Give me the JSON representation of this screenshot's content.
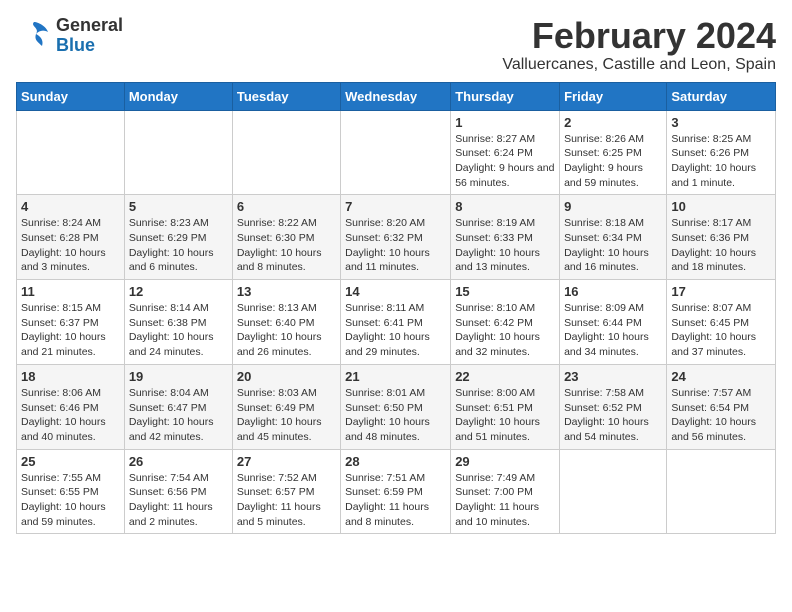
{
  "logo": {
    "general": "General",
    "blue": "Blue"
  },
  "header": {
    "month": "February 2024",
    "location": "Valluercanes, Castille and Leon, Spain"
  },
  "weekdays": [
    "Sunday",
    "Monday",
    "Tuesday",
    "Wednesday",
    "Thursday",
    "Friday",
    "Saturday"
  ],
  "weeks": [
    [
      {
        "day": "",
        "info": ""
      },
      {
        "day": "",
        "info": ""
      },
      {
        "day": "",
        "info": ""
      },
      {
        "day": "",
        "info": ""
      },
      {
        "day": "1",
        "info": "Sunrise: 8:27 AM\nSunset: 6:24 PM\nDaylight: 9 hours and 56 minutes."
      },
      {
        "day": "2",
        "info": "Sunrise: 8:26 AM\nSunset: 6:25 PM\nDaylight: 9 hours and 59 minutes."
      },
      {
        "day": "3",
        "info": "Sunrise: 8:25 AM\nSunset: 6:26 PM\nDaylight: 10 hours and 1 minute."
      }
    ],
    [
      {
        "day": "4",
        "info": "Sunrise: 8:24 AM\nSunset: 6:28 PM\nDaylight: 10 hours and 3 minutes."
      },
      {
        "day": "5",
        "info": "Sunrise: 8:23 AM\nSunset: 6:29 PM\nDaylight: 10 hours and 6 minutes."
      },
      {
        "day": "6",
        "info": "Sunrise: 8:22 AM\nSunset: 6:30 PM\nDaylight: 10 hours and 8 minutes."
      },
      {
        "day": "7",
        "info": "Sunrise: 8:20 AM\nSunset: 6:32 PM\nDaylight: 10 hours and 11 minutes."
      },
      {
        "day": "8",
        "info": "Sunrise: 8:19 AM\nSunset: 6:33 PM\nDaylight: 10 hours and 13 minutes."
      },
      {
        "day": "9",
        "info": "Sunrise: 8:18 AM\nSunset: 6:34 PM\nDaylight: 10 hours and 16 minutes."
      },
      {
        "day": "10",
        "info": "Sunrise: 8:17 AM\nSunset: 6:36 PM\nDaylight: 10 hours and 18 minutes."
      }
    ],
    [
      {
        "day": "11",
        "info": "Sunrise: 8:15 AM\nSunset: 6:37 PM\nDaylight: 10 hours and 21 minutes."
      },
      {
        "day": "12",
        "info": "Sunrise: 8:14 AM\nSunset: 6:38 PM\nDaylight: 10 hours and 24 minutes."
      },
      {
        "day": "13",
        "info": "Sunrise: 8:13 AM\nSunset: 6:40 PM\nDaylight: 10 hours and 26 minutes."
      },
      {
        "day": "14",
        "info": "Sunrise: 8:11 AM\nSunset: 6:41 PM\nDaylight: 10 hours and 29 minutes."
      },
      {
        "day": "15",
        "info": "Sunrise: 8:10 AM\nSunset: 6:42 PM\nDaylight: 10 hours and 32 minutes."
      },
      {
        "day": "16",
        "info": "Sunrise: 8:09 AM\nSunset: 6:44 PM\nDaylight: 10 hours and 34 minutes."
      },
      {
        "day": "17",
        "info": "Sunrise: 8:07 AM\nSunset: 6:45 PM\nDaylight: 10 hours and 37 minutes."
      }
    ],
    [
      {
        "day": "18",
        "info": "Sunrise: 8:06 AM\nSunset: 6:46 PM\nDaylight: 10 hours and 40 minutes."
      },
      {
        "day": "19",
        "info": "Sunrise: 8:04 AM\nSunset: 6:47 PM\nDaylight: 10 hours and 42 minutes."
      },
      {
        "day": "20",
        "info": "Sunrise: 8:03 AM\nSunset: 6:49 PM\nDaylight: 10 hours and 45 minutes."
      },
      {
        "day": "21",
        "info": "Sunrise: 8:01 AM\nSunset: 6:50 PM\nDaylight: 10 hours and 48 minutes."
      },
      {
        "day": "22",
        "info": "Sunrise: 8:00 AM\nSunset: 6:51 PM\nDaylight: 10 hours and 51 minutes."
      },
      {
        "day": "23",
        "info": "Sunrise: 7:58 AM\nSunset: 6:52 PM\nDaylight: 10 hours and 54 minutes."
      },
      {
        "day": "24",
        "info": "Sunrise: 7:57 AM\nSunset: 6:54 PM\nDaylight: 10 hours and 56 minutes."
      }
    ],
    [
      {
        "day": "25",
        "info": "Sunrise: 7:55 AM\nSunset: 6:55 PM\nDaylight: 10 hours and 59 minutes."
      },
      {
        "day": "26",
        "info": "Sunrise: 7:54 AM\nSunset: 6:56 PM\nDaylight: 11 hours and 2 minutes."
      },
      {
        "day": "27",
        "info": "Sunrise: 7:52 AM\nSunset: 6:57 PM\nDaylight: 11 hours and 5 minutes."
      },
      {
        "day": "28",
        "info": "Sunrise: 7:51 AM\nSunset: 6:59 PM\nDaylight: 11 hours and 8 minutes."
      },
      {
        "day": "29",
        "info": "Sunrise: 7:49 AM\nSunset: 7:00 PM\nDaylight: 11 hours and 10 minutes."
      },
      {
        "day": "",
        "info": ""
      },
      {
        "day": "",
        "info": ""
      }
    ]
  ]
}
